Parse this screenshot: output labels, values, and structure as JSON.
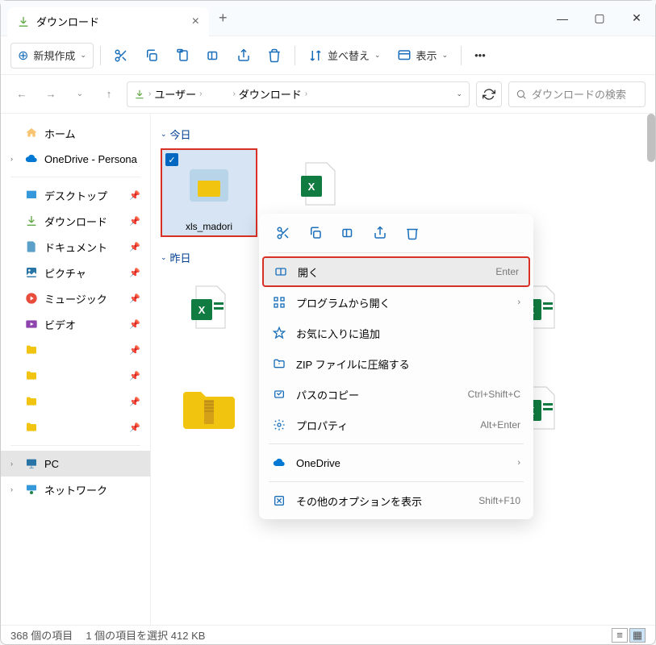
{
  "titlebar": {
    "tab_title": "ダウンロード"
  },
  "toolbar": {
    "new": "新規作成",
    "sort": "並べ替え",
    "view": "表示"
  },
  "breadcrumb": {
    "items": [
      "ユーザー",
      "",
      "ダウンロード"
    ]
  },
  "search": {
    "placeholder": "ダウンロードの検索"
  },
  "sidebar": {
    "home": "ホーム",
    "onedrive": "OneDrive - Persona",
    "desktop": "デスクトップ",
    "downloads": "ダウンロード",
    "documents": "ドキュメント",
    "pictures": "ピクチャ",
    "music": "ミュージック",
    "video": "ビデオ",
    "pc": "PC",
    "network": "ネットワーク"
  },
  "groups": {
    "today": "今日",
    "yesterday": "昨日"
  },
  "files": {
    "selected": "xls_madori"
  },
  "context_menu": {
    "open": "開く",
    "open_shortcut": "Enter",
    "open_with": "プログラムから開く",
    "favorite": "お気に入りに追加",
    "zip": "ZIP ファイルに圧縮する",
    "copy_path": "パスのコピー",
    "copy_path_shortcut": "Ctrl+Shift+C",
    "properties": "プロパティ",
    "properties_shortcut": "Alt+Enter",
    "onedrive": "OneDrive",
    "more": "その他のオプションを表示",
    "more_shortcut": "Shift+F10"
  },
  "status": {
    "count": "368 個の項目",
    "selection": "1 個の項目を選択 412 KB"
  },
  "colors": {
    "accent": "#0067c0",
    "highlight_border": "#d93025"
  }
}
